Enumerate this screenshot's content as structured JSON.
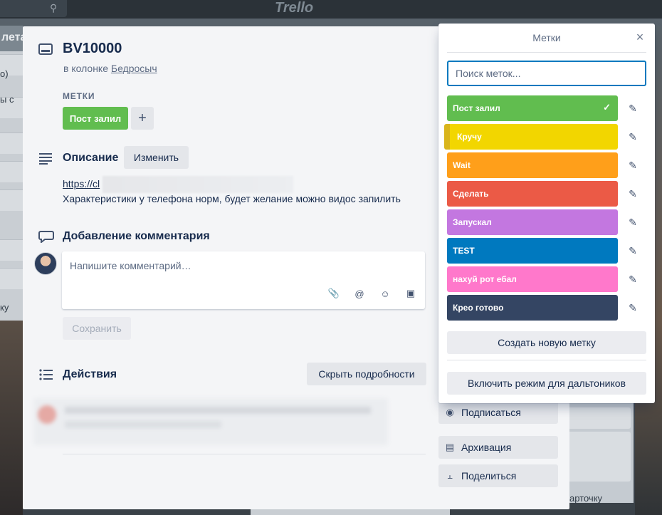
{
  "background": {
    "logo": "Trello",
    "left_column_head": "лета",
    "left_texts": [
      "о)",
      "ы с",
      "ку"
    ],
    "right_column_footer": "арточку"
  },
  "card": {
    "title": "BV10000",
    "in_column_prefix": "в колонке",
    "column_name": "Бедросыч",
    "labels_heading": "МЕТКИ",
    "selected_label": "Пост залил",
    "add_label": "+",
    "description_title": "Описание",
    "edit_button": "Изменить",
    "description_link": "https://cl",
    "description_text": "Характеристики у телефона норм, будет желание можно видос запилить",
    "comment_title": "Добавление комментария",
    "comment_placeholder": "Напишите комментарий…",
    "save_button": "Сохранить",
    "activity_title": "Действия",
    "hide_details_button": "Скрыть подробности"
  },
  "sidebar": {
    "subscribe": "Подписаться",
    "archive": "Архивация",
    "share": "Поделиться"
  },
  "labels_popover": {
    "title": "Метки",
    "close": "×",
    "search_placeholder": "Поиск меток...",
    "labels": [
      {
        "name": "Пост залил",
        "color": "#61bd4f",
        "checked": true
      },
      {
        "name": "Кручу",
        "color": "#f2d600",
        "checked": false
      },
      {
        "name": "Wait",
        "color": "#ff9f1a",
        "checked": false
      },
      {
        "name": "Сделать",
        "color": "#eb5a46",
        "checked": false
      },
      {
        "name": "Запускал",
        "color": "#c377e0",
        "checked": false
      },
      {
        "name": "TEST",
        "color": "#0079bf",
        "checked": false
      },
      {
        "name": "нахуй рот ебал",
        "color": "#ff78cb",
        "checked": false
      },
      {
        "name": "Крео готово",
        "color": "#344563",
        "checked": false
      }
    ],
    "create_button": "Создать новую метку",
    "colorblind_button": "Включить режим для дальтоников"
  },
  "colors": {
    "accent": "#0079bf",
    "label_green": "#61bd4f"
  }
}
